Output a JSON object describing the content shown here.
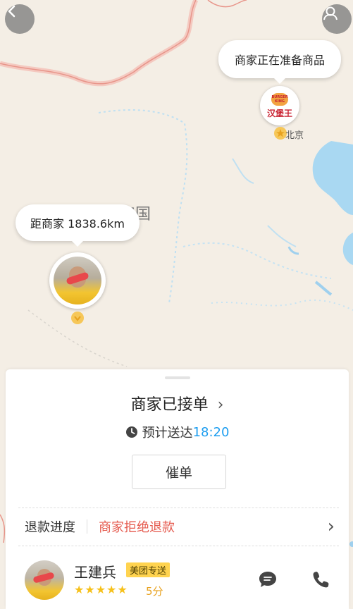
{
  "map": {
    "merchant_bubble": "商家正在准备商品",
    "merchant_logo_line1": "BURGER",
    "merchant_logo_line2": "KING",
    "merchant_logo_cn": "汉堡王",
    "city_label": "北京",
    "country_label": "中华人民共和国",
    "rider_bubble": "距商家 1838.6km"
  },
  "order": {
    "status": "商家已接单",
    "eta_label": "预计送达",
    "eta_time": "18:20",
    "urge_button": "催单",
    "refund_label": "退款进度",
    "refund_status": "商家拒绝退款"
  },
  "rider": {
    "name": "王建兵",
    "badge": "美团专送",
    "rating": "5分",
    "stars": 5
  },
  "colors": {
    "accent_blue": "#1e9ef0",
    "refund_red": "#e55a4e",
    "badge_yellow": "#ffd34f",
    "star_yellow": "#f6c11b"
  }
}
